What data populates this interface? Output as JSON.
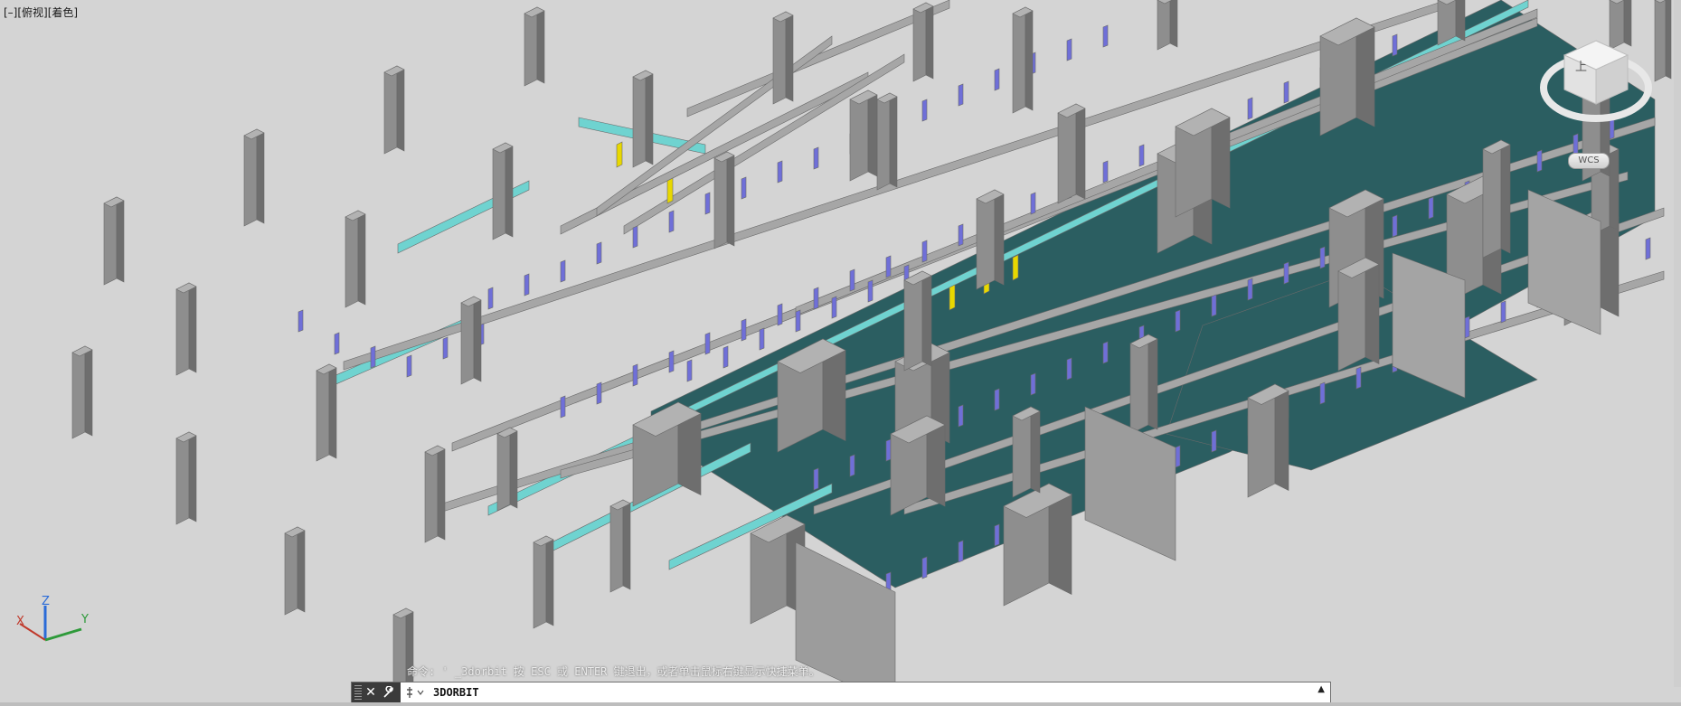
{
  "viewport": {
    "view_label": "[–][俯视][着色]",
    "colors": {
      "background": "#d4d4d4",
      "slab": "#2b5e61",
      "column": "#9a9a9a",
      "beam_cyan": "#6fd3d0",
      "hanger": "#6f6fd8",
      "highlight": "#e8d800"
    }
  },
  "command": {
    "history": "命令: ' _3dorbit 按 ESC 或 ENTER 键退出，或者单击鼠标右键显示快捷菜单。",
    "input_value": "3DORBIT",
    "close_icon": "✕",
    "customize_icon": "wrench-icon",
    "prompt_icon": "command-prompt-icon",
    "expand_icon": "▲"
  },
  "ucs": {
    "x_label": "X",
    "y_label": "Y",
    "z_label": "Z"
  },
  "viewcube": {
    "face_label": "上",
    "wcs_label": "WCS"
  }
}
